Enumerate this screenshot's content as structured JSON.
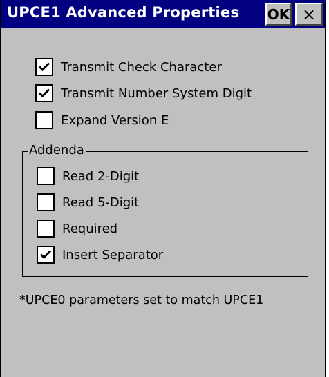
{
  "window": {
    "title": "UPCE1 Advanced Properties",
    "ok_label": "OK",
    "close_label": "×"
  },
  "options": [
    {
      "label": "Transmit Check Character",
      "checked": true
    },
    {
      "label": "Transmit Number System Digit",
      "checked": true
    },
    {
      "label": "Expand Version E",
      "checked": false
    }
  ],
  "addenda": {
    "legend": "Addenda",
    "items": [
      {
        "label": "Read 2-Digit",
        "checked": false
      },
      {
        "label": "Read 5-Digit",
        "checked": false
      },
      {
        "label": "Required",
        "checked": false
      },
      {
        "label": "Insert Separator",
        "checked": true
      }
    ]
  },
  "footnote": "*UPCE0 parameters set to match UPCE1",
  "colors": {
    "titlebar": "#000080",
    "background": "#c0c0c0"
  }
}
